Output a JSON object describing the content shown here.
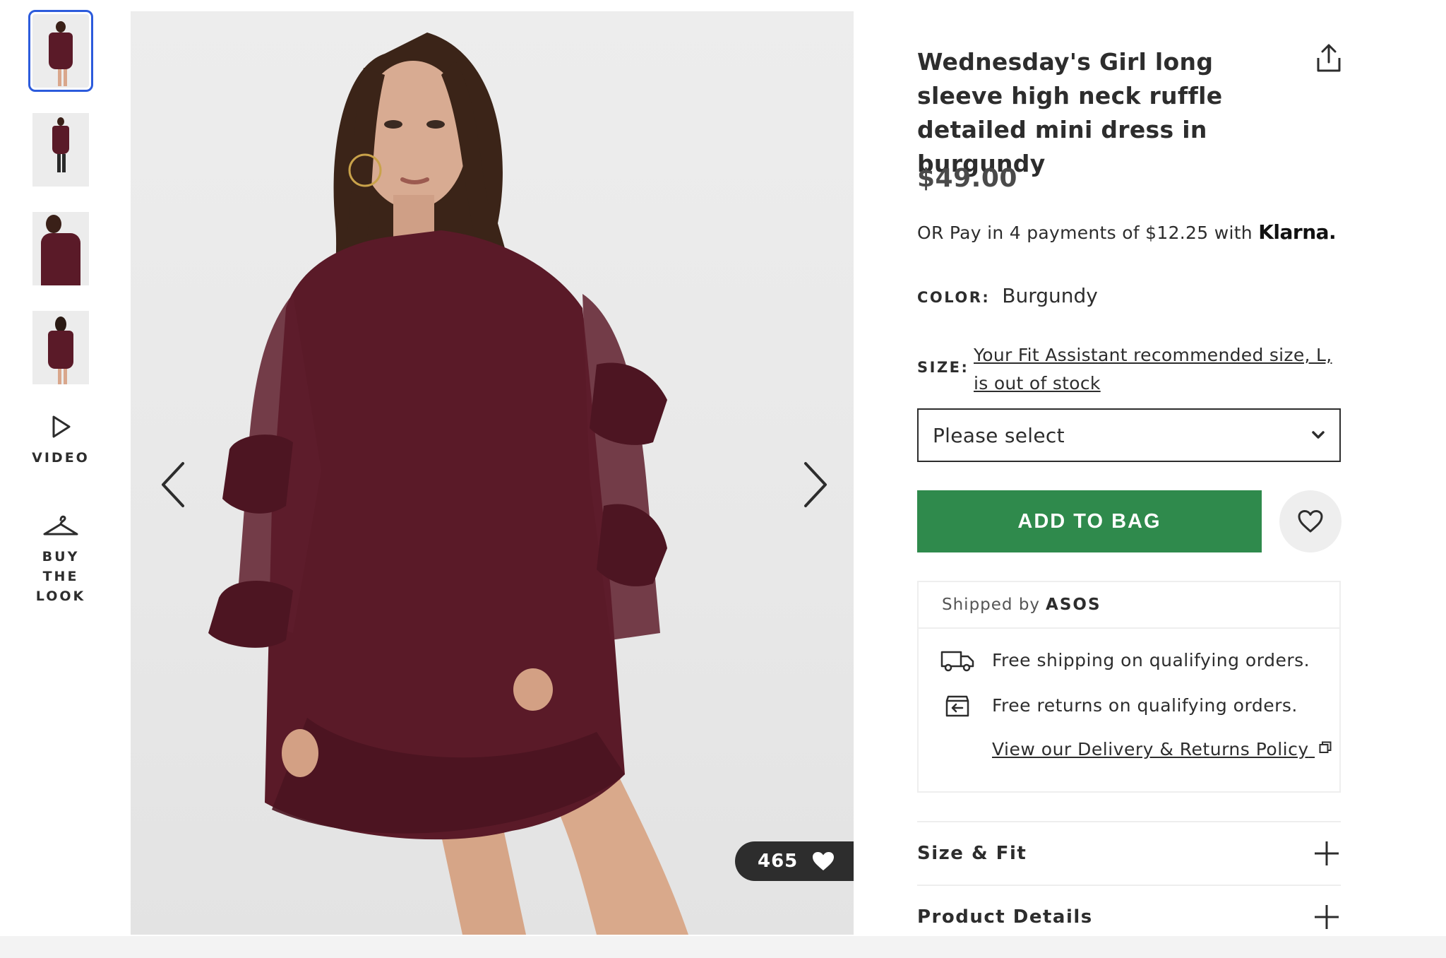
{
  "gallery": {
    "thumbnails": [
      {
        "alt": "Front view",
        "selected": true
      },
      {
        "alt": "Full length view",
        "selected": false
      },
      {
        "alt": "Side view",
        "selected": false
      },
      {
        "alt": "Back view",
        "selected": false
      }
    ],
    "video_label": "VIDEO",
    "buy_look_label": "BUY THE LOOK",
    "likes_count": "465"
  },
  "product": {
    "title": "Wednesday's Girl long sleeve high neck ruffle detailed mini dress in burgundy",
    "price": "$49.00",
    "klarna_text": "OR Pay in 4 payments of $12.25 with",
    "klarna_brand": "Klarna.",
    "color_label": "COLOR:",
    "color_value": "Burgundy",
    "size_label": "SIZE:",
    "size_link": "Your Fit Assistant recommended size, L, is out of stock",
    "size_select": "Please select",
    "add_to_bag": "ADD TO BAG"
  },
  "shipping": {
    "shipped_by_label": "Shipped by",
    "shipped_by_brand": "ASOS",
    "free_shipping": "Free shipping on qualifying orders.",
    "free_returns": "Free returns on qualifying orders.",
    "policy_link": "View our Delivery & Returns Policy"
  },
  "accordions": [
    {
      "label": "Size & Fit"
    },
    {
      "label": "Product Details"
    }
  ],
  "colors": {
    "add_to_bag_bg": "#2f8a4c",
    "selected_thumb_outline": "#2c5bdc",
    "dress": "#5a1a28",
    "text": "#2d2d2d"
  }
}
